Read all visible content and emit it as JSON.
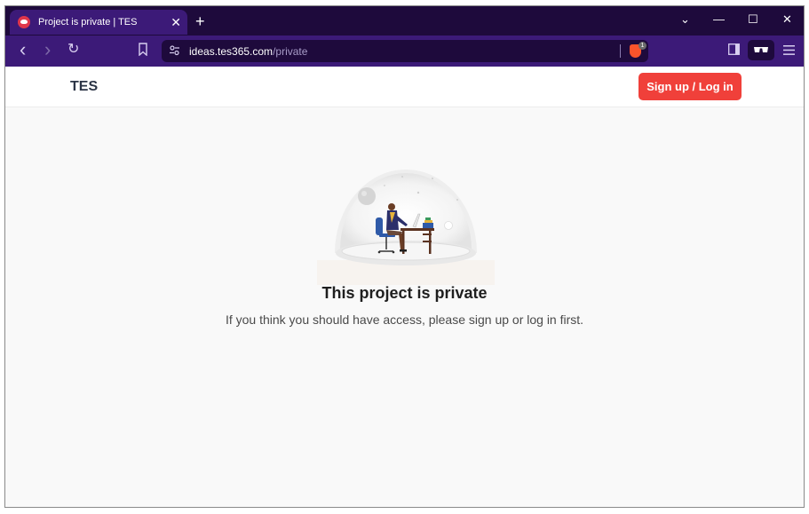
{
  "browser": {
    "tab": {
      "title": "Project is private | TES",
      "close_glyph": "✕"
    },
    "new_tab_glyph": "+",
    "window_controls": {
      "tab_search": "⌄",
      "minimize": "—",
      "maximize": "☐",
      "close": "✕"
    },
    "nav": {
      "back": "‹",
      "forward": "›",
      "reload": "↻",
      "bookmark": "🔖"
    },
    "address": {
      "domain": "ideas.tes365.com",
      "path": "/private",
      "shield_count": "1"
    },
    "colors": {
      "tabstrip": "#1e0a3c",
      "toolbar": "#3c1a78",
      "shield": "#fb542b"
    }
  },
  "header": {
    "brand": "TES",
    "signup_label": "Sign up / Log in",
    "signup_color": "#f0403a"
  },
  "main": {
    "heading": "This project is private",
    "message": "If you think you should have access, please sign up or log in first."
  }
}
